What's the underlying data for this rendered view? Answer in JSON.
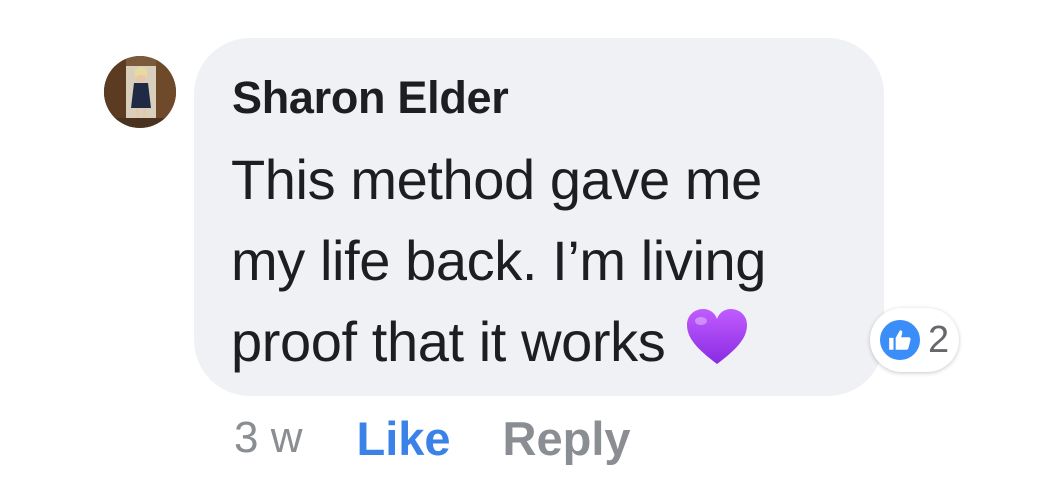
{
  "comment": {
    "author": "Sharon Elder",
    "text_lines": [
      "This method gave me",
      "my life back. I’m living",
      "proof that it works"
    ],
    "emoji_icon": "purple-heart-icon",
    "emoji_color": "#a23ff0"
  },
  "reactions": {
    "icon": "thumbs-up-icon",
    "color": "#3b8df7",
    "count": "2"
  },
  "actions": {
    "timestamp": "3 w",
    "like_label": "Like",
    "reply_label": "Reply",
    "like_color": "#3b82e8"
  }
}
